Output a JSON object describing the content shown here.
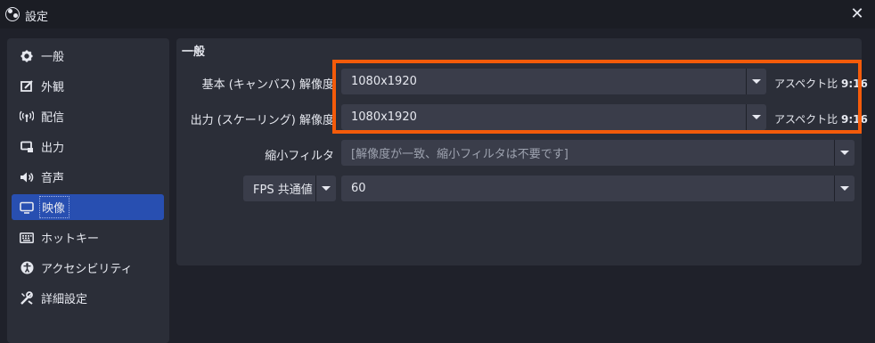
{
  "window": {
    "title": "設定",
    "close_glyph": "✕"
  },
  "sidebar": {
    "items": [
      {
        "label": "一般",
        "icon": "gear-icon",
        "active": false
      },
      {
        "label": "外観",
        "icon": "appearance-icon",
        "active": false
      },
      {
        "label": "配信",
        "icon": "broadcast-icon",
        "active": false
      },
      {
        "label": "出力",
        "icon": "output-icon",
        "active": false
      },
      {
        "label": "音声",
        "icon": "speaker-icon",
        "active": false
      },
      {
        "label": "映像",
        "icon": "monitor-icon",
        "active": true
      },
      {
        "label": "ホットキー",
        "icon": "keyboard-icon",
        "active": false
      },
      {
        "label": "アクセシビリティ",
        "icon": "accessibility-icon",
        "active": false
      },
      {
        "label": "詳細設定",
        "icon": "tools-icon",
        "active": false
      }
    ]
  },
  "panel": {
    "title": "一般",
    "base_resolution": {
      "label": "基本 (キャンバス) 解像度",
      "value": "1080x1920",
      "aspect_prefix": "アスペクト比",
      "aspect_value": "9:16"
    },
    "output_resolution": {
      "label": "出力 (スケーリング) 解像度",
      "value": "1080x1920",
      "aspect_prefix": "アスペクト比",
      "aspect_value": "9:16"
    },
    "downscale_filter": {
      "label": "縮小フィルタ",
      "value": "[解像度が一致、縮小フィルタは不要です]"
    },
    "fps": {
      "type_value": "FPS 共通値",
      "value": "60"
    }
  },
  "colors": {
    "highlight": "#f45b0a",
    "accent": "#284fb1"
  }
}
